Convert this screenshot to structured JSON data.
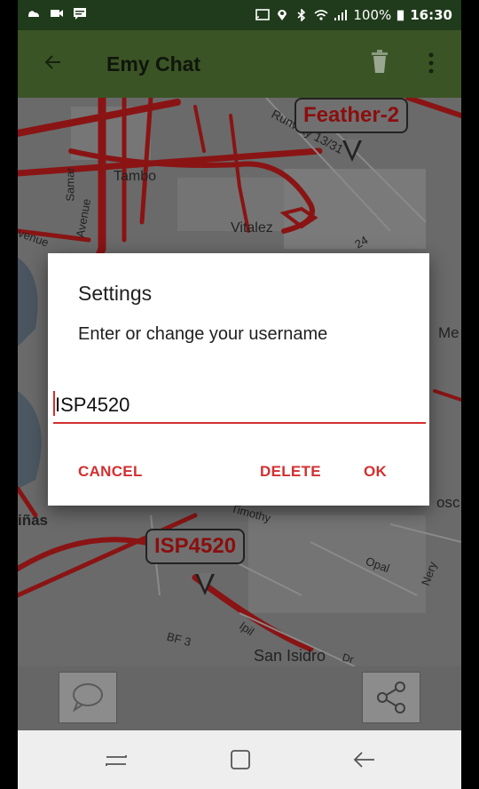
{
  "status_bar": {
    "left_icons": [
      "weather-icon",
      "video-icon",
      "message-icon"
    ],
    "right_icons": [
      "cast-icon",
      "location-icon",
      "bluetooth-icon",
      "wifi-icon",
      "signal-icon"
    ],
    "battery": "100%",
    "time": "16:30"
  },
  "toolbar": {
    "title": "Emy Chat",
    "icons": [
      "back-arrow-icon",
      "trash-icon",
      "more-vert-icon"
    ]
  },
  "map": {
    "labels": {
      "runway": "Runway 13/31",
      "tambo": "Tambo",
      "vitalez": "Vitalez",
      "samar": "Samar",
      "avenue": "Avenue",
      "avenue2": "venue",
      "me": "Me",
      "pinas": "iñas",
      "timothy": "Timothy",
      "opal": "Opal",
      "nery": "Nery",
      "ipil": "Ipil",
      "bf3": "BF 3",
      "san_isidro": "San Isidro",
      "dr": "Dr",
      "osc": "osc",
      "num24": "24"
    },
    "callouts": {
      "top": "Feather-2",
      "bottom": "ISP4520"
    }
  },
  "dialog": {
    "title": "Settings",
    "message": "Enter or change your username",
    "input_value": "ISP4520",
    "buttons": {
      "cancel": "CANCEL",
      "delete": "DELETE",
      "ok": "OK"
    }
  },
  "bottom_bar": {
    "icons": [
      "chat-bubble-icon",
      "share-icon"
    ]
  },
  "nav_bar": {
    "icons": [
      "recents-icon",
      "home-icon",
      "back-icon"
    ]
  },
  "colors": {
    "accent": "#d32f2f",
    "toolbar": "#3b5426",
    "status_bar": "#1f3b1b",
    "callout_text": "#8b0e0e"
  }
}
